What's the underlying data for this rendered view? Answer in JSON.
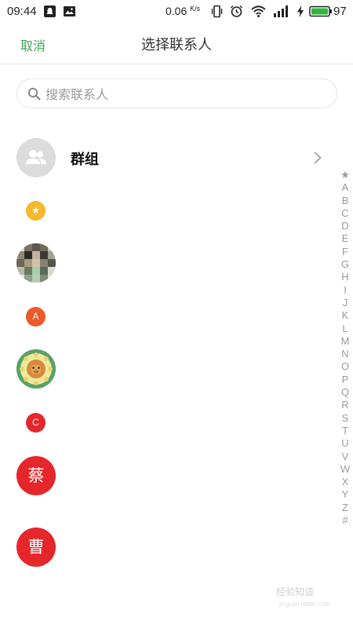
{
  "status_bar": {
    "time": "09:44",
    "speed_value": "0.06",
    "speed_unit": "K/s",
    "battery": "97",
    "icons": [
      "notification-icon",
      "image-icon",
      "vibrate-icon",
      "alarm-icon",
      "wifi-icon",
      "signal-icon",
      "charging-icon",
      "battery-icon"
    ]
  },
  "nav": {
    "cancel_label": "取消",
    "title": "选择联系人"
  },
  "search": {
    "placeholder": "搜索联系人",
    "value": ""
  },
  "group": {
    "label": "群组",
    "icon": "group-icon"
  },
  "sections": {
    "star": "★",
    "a": "A",
    "c": "C"
  },
  "contacts": {
    "cai": "蔡",
    "cao": "曹"
  },
  "index_letters": [
    "★",
    "A",
    "B",
    "C",
    "D",
    "E",
    "F",
    "G",
    "H",
    "I",
    "J",
    "K",
    "L",
    "M",
    "N",
    "O",
    "P",
    "Q",
    "R",
    "S",
    "T",
    "U",
    "V",
    "W",
    "X",
    "Y",
    "Z",
    "#"
  ],
  "watermark": {
    "main": "经验知道",
    "sub": "jingyan.baidu.com"
  },
  "colors": {
    "accent_green": "#3aa857",
    "star_badge": "#f5b82e",
    "a_badge": "#ea5a2a",
    "c_badge": "#e5262b",
    "contact_red": "#e5262b"
  }
}
